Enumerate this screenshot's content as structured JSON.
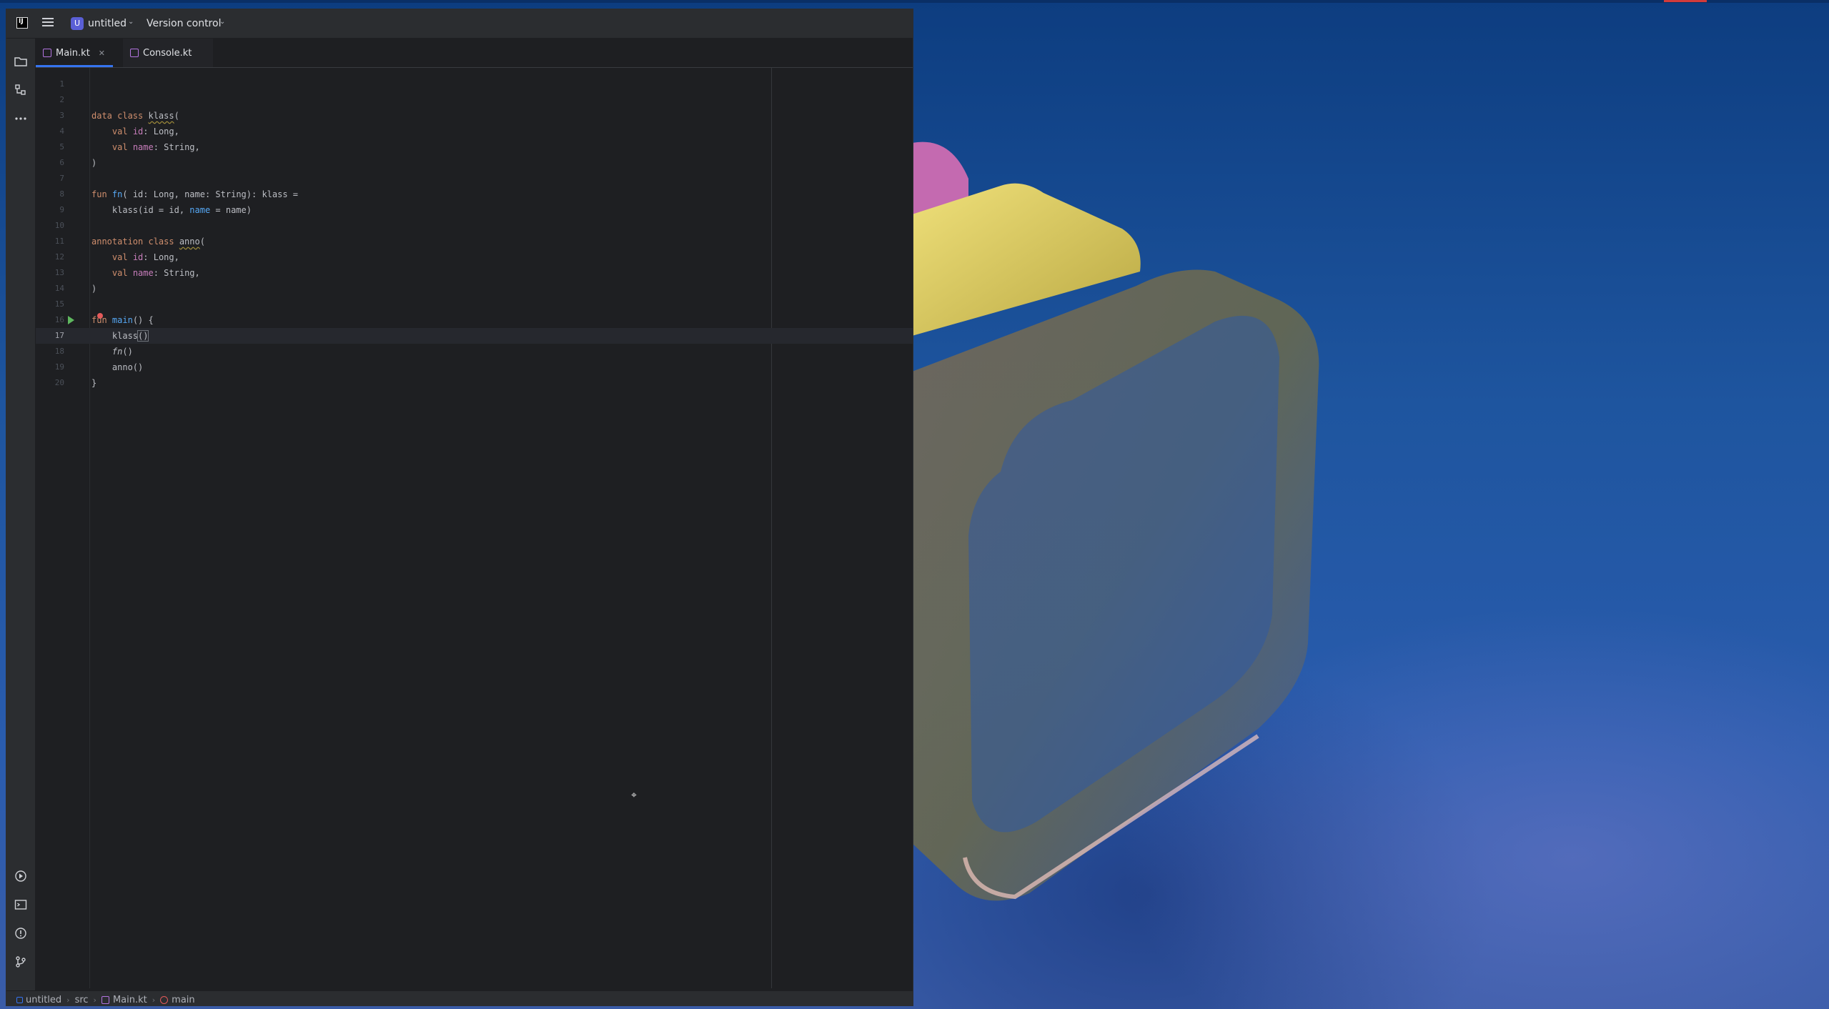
{
  "window": {
    "project_badge": "U",
    "project_name": "untitled",
    "version_control": "Version control"
  },
  "tabs": [
    {
      "label": "Main.kt",
      "active": true
    },
    {
      "label": "Console.kt",
      "active": false
    }
  ],
  "editor": {
    "current_line": 17,
    "lines": [
      {
        "n": "1",
        "code": ""
      },
      {
        "n": "2",
        "code": ""
      },
      {
        "n": "3",
        "code": "data class klass("
      },
      {
        "n": "4",
        "code": "    val id: Long,"
      },
      {
        "n": "5",
        "code": "    val name: String,"
      },
      {
        "n": "6",
        "code": ")"
      },
      {
        "n": "7",
        "code": ""
      },
      {
        "n": "8",
        "code": "fun fn( id: Long, name: String): klass ="
      },
      {
        "n": "9",
        "code": "    klass(id = id, name = name)"
      },
      {
        "n": "10",
        "code": ""
      },
      {
        "n": "11",
        "code": "annotation class anno("
      },
      {
        "n": "12",
        "code": "    val id: Long,"
      },
      {
        "n": "13",
        "code": "    val name: String,"
      },
      {
        "n": "14",
        "code": ")"
      },
      {
        "n": "15",
        "code": ""
      },
      {
        "n": "16",
        "code": "fun main() {"
      },
      {
        "n": "17",
        "code": "    klass()"
      },
      {
        "n": "18",
        "code": "    fn()"
      },
      {
        "n": "19",
        "code": "    anno()"
      },
      {
        "n": "20",
        "code": "}"
      }
    ]
  },
  "breadcrumbs": [
    "untitled",
    "src",
    "Main.kt",
    "main"
  ],
  "icons": {
    "tool_project": "folder-icon",
    "tool_structure": "structure-icon",
    "tool_more": "more-icon",
    "tool_run": "run-icon",
    "tool_terminal": "terminal-icon",
    "tool_problems": "problems-icon",
    "tool_git": "git-icon"
  },
  "colors": {
    "keyword": "#cf8e6d",
    "function": "#56a8f5",
    "property": "#c77dbb",
    "accent": "#3574f0"
  }
}
